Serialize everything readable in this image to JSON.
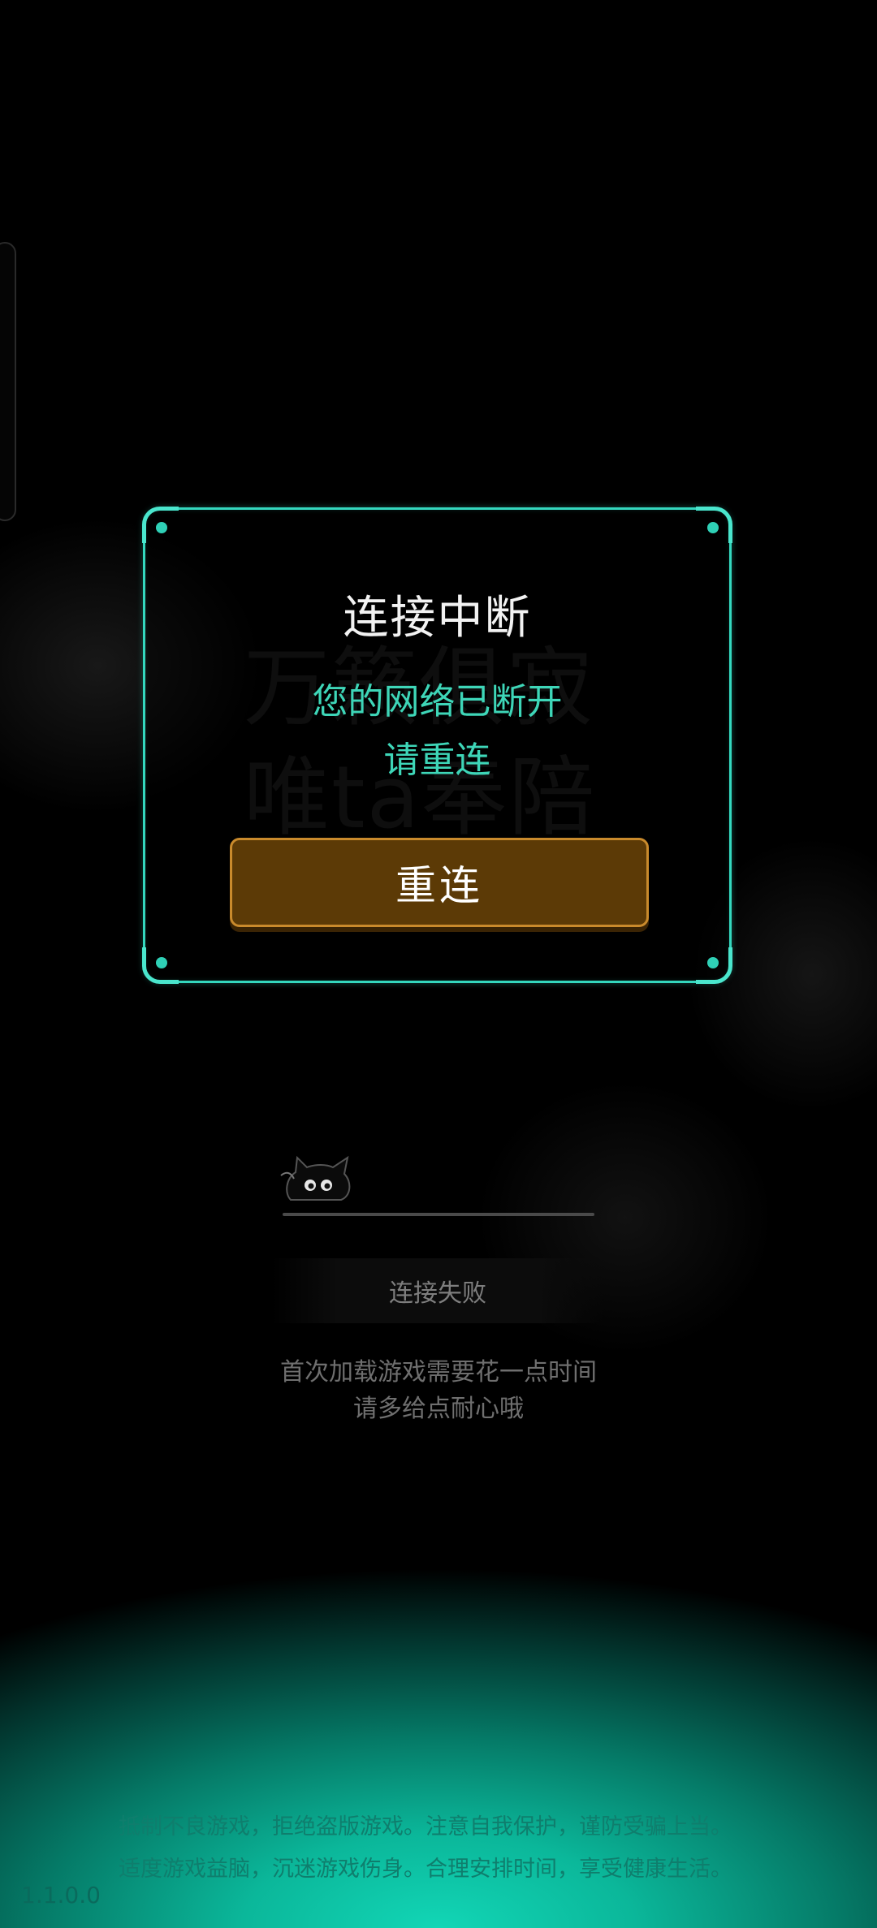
{
  "background": {
    "slogan_line1": "万籁俱寂",
    "slogan_line2": "唯ta奉陪"
  },
  "dialog": {
    "title": "连接中断",
    "message_line1": "您的网络已断开",
    "message_line2": "请重连",
    "button_label": "重连",
    "accent_color": "#34d8be",
    "button_color": "#5c3a06"
  },
  "loading": {
    "status": "连接失败",
    "tip_line1": "首次加载游戏需要花一点时间",
    "tip_line2": "请多给点耐心哦",
    "progress": 0
  },
  "footer": {
    "notice_line1": "抵制不良游戏，拒绝盗版游戏。注意自我保护，谨防受骗上当。",
    "notice_line2": "适度游戏益脑，沉迷游戏伤身。合理安排时间，享受健康生活。",
    "version": "1.1.0.0"
  }
}
